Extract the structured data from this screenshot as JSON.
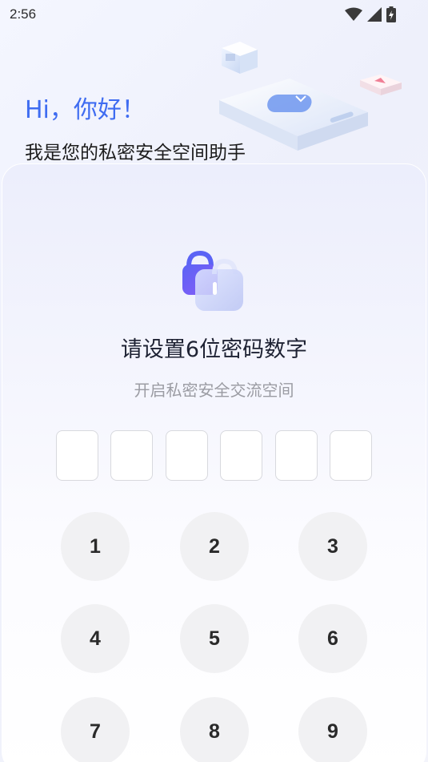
{
  "status_bar": {
    "time": "2:56",
    "icons": [
      "wifi-icon",
      "signal-icon",
      "battery-charging-icon"
    ]
  },
  "header": {
    "greeting": "Hi，你好！",
    "subtitle": "我是您的私密安全空间助手"
  },
  "card": {
    "title": "请设置6位密码数字",
    "subtitle": "开启私密安全交流空间",
    "pin_length": 6
  },
  "keypad": {
    "keys": [
      "1",
      "2",
      "3",
      "4",
      "5",
      "6",
      "7",
      "8",
      "9"
    ]
  },
  "colors": {
    "accent": "#3f6cf1",
    "key_bg": "#f1f1f3",
    "text_dark": "#1e2233",
    "text_muted": "#9b9ca3"
  }
}
